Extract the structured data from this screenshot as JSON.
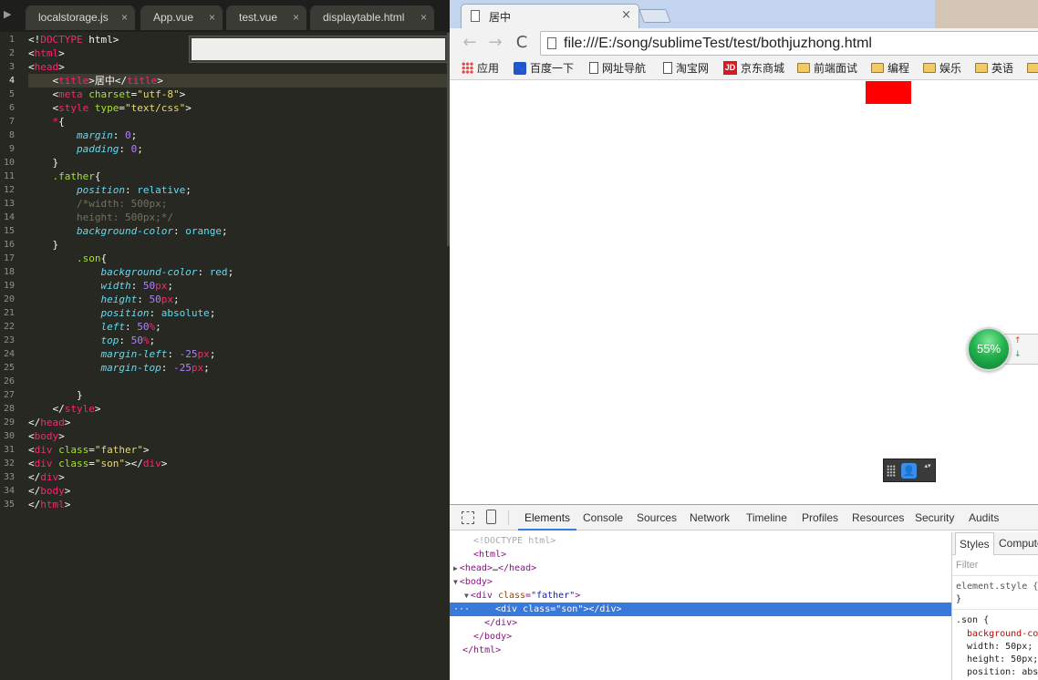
{
  "editor": {
    "sidebar_toggle": "▶",
    "close_glyph": "×",
    "tabs": [
      {
        "label": "localstorage.js"
      },
      {
        "label": "App.vue"
      },
      {
        "label": "test.vue"
      },
      {
        "label": "displaytable.html"
      }
    ],
    "line_numbers": [
      "1",
      "2",
      "3",
      "4",
      "5",
      "6",
      "7",
      "8",
      "9",
      "10",
      "11",
      "12",
      "13",
      "14",
      "15",
      "16",
      "17",
      "18",
      "19",
      "20",
      "21",
      "22",
      "23",
      "24",
      "25",
      "26",
      "27",
      "28",
      "29",
      "30",
      "31",
      "32",
      "33",
      "34",
      "35"
    ],
    "current_line": 4,
    "code_lines": [
      [
        [
          "t-txt",
          "<!"
        ],
        [
          "t-tag",
          "DOCTYPE"
        ],
        [
          "t-txt",
          " html>"
        ]
      ],
      [
        [
          "t-txt",
          "<"
        ],
        [
          "t-tag",
          "html"
        ],
        [
          "t-txt",
          ">"
        ]
      ],
      [
        [
          "t-txt",
          "<"
        ],
        [
          "t-tag",
          "head"
        ],
        [
          "t-txt",
          ">"
        ]
      ],
      [
        [
          "t-txt",
          "    <"
        ],
        [
          "t-tag",
          "title"
        ],
        [
          "t-txt",
          ">居中</"
        ],
        [
          "t-tag",
          "title"
        ],
        [
          "t-txt",
          ">"
        ]
      ],
      [
        [
          "t-txt",
          "    <"
        ],
        [
          "t-tag",
          "meta"
        ],
        [
          "t-attr",
          " charset"
        ],
        [
          "t-txt",
          "="
        ],
        [
          "t-str",
          "\"utf-8\""
        ],
        [
          "t-txt",
          ">"
        ]
      ],
      [
        [
          "t-txt",
          "    <"
        ],
        [
          "t-tag",
          "style"
        ],
        [
          "t-attr",
          " type"
        ],
        [
          "t-txt",
          "="
        ],
        [
          "t-str",
          "\"text/css\""
        ],
        [
          "t-txt",
          ">"
        ]
      ],
      [
        [
          "t-tag",
          "    *"
        ],
        [
          "t-pun",
          "{"
        ]
      ],
      [
        [
          "t-prop",
          "        margin"
        ],
        [
          "t-pun",
          ": "
        ],
        [
          "t-num",
          "0"
        ],
        [
          "t-pun",
          ";"
        ]
      ],
      [
        [
          "t-prop",
          "        padding"
        ],
        [
          "t-pun",
          ": "
        ],
        [
          "t-num",
          "0"
        ],
        [
          "t-pun",
          ";"
        ]
      ],
      [
        [
          "t-pun",
          "    }"
        ]
      ],
      [
        [
          "t-sel",
          "    .father"
        ],
        [
          "t-pun",
          "{"
        ]
      ],
      [
        [
          "t-prop",
          "        position"
        ],
        [
          "t-pun",
          ": "
        ],
        [
          "t-val",
          "relative"
        ],
        [
          "t-pun",
          ";"
        ]
      ],
      [
        [
          "t-com",
          "        /*width: 500px;"
        ]
      ],
      [
        [
          "t-com",
          "        height: 500px;*/"
        ]
      ],
      [
        [
          "t-prop",
          "        background-color"
        ],
        [
          "t-pun",
          ": "
        ],
        [
          "t-val",
          "orange"
        ],
        [
          "t-pun",
          ";"
        ]
      ],
      [
        [
          "t-pun",
          "    }"
        ]
      ],
      [
        [
          "t-sel",
          "        .son"
        ],
        [
          "t-pun",
          "{"
        ]
      ],
      [
        [
          "t-prop",
          "            background-color"
        ],
        [
          "t-pun",
          ": "
        ],
        [
          "t-val",
          "red"
        ],
        [
          "t-pun",
          ";"
        ]
      ],
      [
        [
          "t-prop",
          "            width"
        ],
        [
          "t-pun",
          ": "
        ],
        [
          "t-num",
          "50"
        ],
        [
          "t-unit",
          "px"
        ],
        [
          "t-pun",
          ";"
        ]
      ],
      [
        [
          "t-prop",
          "            height"
        ],
        [
          "t-pun",
          ": "
        ],
        [
          "t-num",
          "50"
        ],
        [
          "t-unit",
          "px"
        ],
        [
          "t-pun",
          ";"
        ]
      ],
      [
        [
          "t-prop",
          "            position"
        ],
        [
          "t-pun",
          ": "
        ],
        [
          "t-val",
          "absolute"
        ],
        [
          "t-pun",
          ";"
        ]
      ],
      [
        [
          "t-prop",
          "            left"
        ],
        [
          "t-pun",
          ": "
        ],
        [
          "t-num",
          "50"
        ],
        [
          "t-unit",
          "%"
        ],
        [
          "t-pun",
          ";"
        ]
      ],
      [
        [
          "t-prop",
          "            top"
        ],
        [
          "t-pun",
          ": "
        ],
        [
          "t-num",
          "50"
        ],
        [
          "t-unit",
          "%"
        ],
        [
          "t-pun",
          ";"
        ]
      ],
      [
        [
          "t-prop",
          "            margin-left"
        ],
        [
          "t-pun",
          ": "
        ],
        [
          "t-num",
          "-25"
        ],
        [
          "t-unit",
          "px"
        ],
        [
          "t-pun",
          ";"
        ]
      ],
      [
        [
          "t-prop",
          "            margin-top"
        ],
        [
          "t-pun",
          ": "
        ],
        [
          "t-num",
          "-25"
        ],
        [
          "t-unit",
          "px"
        ],
        [
          "t-pun",
          ";"
        ]
      ],
      [
        [
          "t-txt",
          " "
        ]
      ],
      [
        [
          "t-pun",
          "        }"
        ]
      ],
      [
        [
          "t-txt",
          "    </"
        ],
        [
          "t-tag",
          "style"
        ],
        [
          "t-txt",
          ">"
        ]
      ],
      [
        [
          "t-txt",
          "</"
        ],
        [
          "t-tag",
          "head"
        ],
        [
          "t-txt",
          ">"
        ]
      ],
      [
        [
          "t-txt",
          "<"
        ],
        [
          "t-tag",
          "body"
        ],
        [
          "t-txt",
          ">"
        ]
      ],
      [
        [
          "t-txt",
          "<"
        ],
        [
          "t-tag",
          "div"
        ],
        [
          "t-attr",
          " class"
        ],
        [
          "t-txt",
          "="
        ],
        [
          "t-str",
          "\"father\""
        ],
        [
          "t-txt",
          ">"
        ]
      ],
      [
        [
          "t-txt",
          "<"
        ],
        [
          "t-tag",
          "div"
        ],
        [
          "t-attr",
          " class"
        ],
        [
          "t-txt",
          "="
        ],
        [
          "t-str",
          "\"son\""
        ],
        [
          "t-txt",
          "></"
        ],
        [
          "t-tag",
          "div"
        ],
        [
          "t-txt",
          ">"
        ]
      ],
      [
        [
          "t-txt",
          "</"
        ],
        [
          "t-tag",
          "div"
        ],
        [
          "t-txt",
          ">"
        ]
      ],
      [
        [
          "t-txt",
          "</"
        ],
        [
          "t-tag",
          "body"
        ],
        [
          "t-txt",
          ">"
        ]
      ],
      [
        [
          "t-txt",
          "</"
        ],
        [
          "t-tag",
          "html"
        ],
        [
          "t-txt",
          ">"
        ]
      ]
    ]
  },
  "browser": {
    "tab_title": "居中",
    "tab_close": "×",
    "ghost_tab_titles": [
      "",
      ""
    ],
    "url": "file:///E:/song/sublimeTest/test/bothjuzhong.html",
    "nav": {
      "back": "←",
      "forward": "→",
      "reload": "C"
    },
    "bookmarks": [
      {
        "label": "应用",
        "icon": "apps-icon"
      },
      {
        "label": "百度一下",
        "icon": "baidu-paw-icon"
      },
      {
        "label": "网址导航",
        "icon": "page-icon"
      },
      {
        "label": "淘宝网",
        "icon": "page-icon"
      },
      {
        "label": "京东商城",
        "icon": "jd-icon"
      },
      {
        "label": "前端面试",
        "icon": "folder-icon"
      },
      {
        "label": "编程",
        "icon": "folder-icon"
      },
      {
        "label": "娱乐",
        "icon": "folder-icon"
      },
      {
        "label": "英语",
        "icon": "folder-icon"
      }
    ],
    "jd_icon_text": "JD",
    "speed_widget": {
      "percent": "55%",
      "up": "↑",
      "down": "↓"
    },
    "ime": {
      "user": "👤",
      "arrows": "▴▾"
    },
    "colors": {
      "son_box": "#ff0000"
    }
  },
  "devtools": {
    "tabs": [
      "Elements",
      "Console",
      "Sources",
      "Network",
      "Timeline",
      "Profiles",
      "Resources",
      "Security",
      "Audits"
    ],
    "active_tab": "Elements",
    "dom_ellipsis": "···",
    "dom_lines": [
      {
        "indent": 1,
        "tri": "",
        "parts": [
          [
            "d-gray",
            "<!DOCTYPE html>"
          ]
        ]
      },
      {
        "indent": 1,
        "tri": "",
        "parts": [
          [
            "d-tag",
            "<html>"
          ]
        ]
      },
      {
        "indent": 0,
        "tri": "▶",
        "parts": [
          [
            "d-tag",
            "<head>"
          ],
          [
            "d-txt",
            "…"
          ],
          [
            "d-tag",
            "</head>"
          ]
        ]
      },
      {
        "indent": 0,
        "tri": "▼",
        "parts": [
          [
            "d-tag",
            "<body>"
          ]
        ]
      },
      {
        "indent": 1,
        "tri": "▼",
        "parts": [
          [
            "d-tag",
            "<div "
          ],
          [
            "d-attr",
            "class"
          ],
          [
            "d-tag",
            "="
          ],
          [
            "d-val",
            "\"father\""
          ],
          [
            "d-tag",
            ">"
          ]
        ]
      },
      {
        "indent": 3,
        "tri": "",
        "sel": true,
        "parts": [
          [
            "d-tag",
            "<div "
          ],
          [
            "d-attr",
            "class"
          ],
          [
            "d-tag",
            "="
          ],
          [
            "d-val",
            "\"son\""
          ],
          [
            "d-tag",
            "></div>"
          ]
        ]
      },
      {
        "indent": 2,
        "tri": "",
        "parts": [
          [
            "d-tag",
            "</div>"
          ]
        ]
      },
      {
        "indent": 1,
        "tri": "",
        "parts": [
          [
            "d-tag",
            "</body>"
          ]
        ]
      },
      {
        "indent": 0,
        "tri": "",
        "parts": [
          [
            "d-tag",
            "</html>"
          ]
        ]
      }
    ],
    "styles": {
      "tabs": [
        "Styles",
        "Computed"
      ],
      "filter_placeholder": "Filter",
      "element_style": "element.style {",
      "close_brace": "}",
      "rule_selector": ".son {",
      "rule_props": [
        "background-color: red;",
        "width: 50px;",
        "height: 50px;",
        "position: absolute;"
      ]
    }
  }
}
